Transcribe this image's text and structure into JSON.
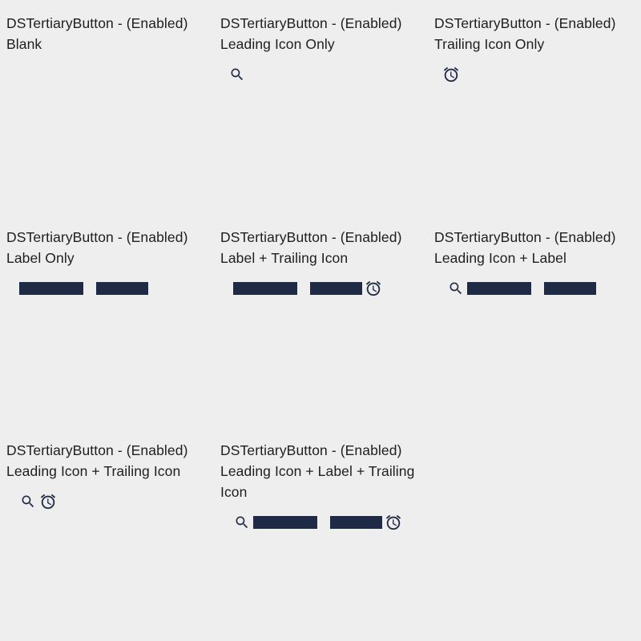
{
  "colors": {
    "background": "#eeeeee",
    "button_content": "#1f2a44",
    "text": "#1e1e1e"
  },
  "icons": {
    "leading": "search-icon",
    "trailing": "alarm-clock-icon"
  },
  "cells": [
    {
      "title_line1": "DSTertiaryButton - (Enabled)",
      "title_line2": "Blank",
      "variant": "blank"
    },
    {
      "title_line1": "DSTertiaryButton - (Enabled)",
      "title_line2": "Leading Icon Only",
      "variant": "leading-icon-only"
    },
    {
      "title_line1": "DSTertiaryButton - (Enabled)",
      "title_line2": "Trailing Icon Only",
      "variant": "trailing-icon-only"
    },
    {
      "title_line1": "DSTertiaryButton - (Enabled)",
      "title_line2": "Label Only",
      "variant": "label-only"
    },
    {
      "title_line1": "DSTertiaryButton - (Enabled)",
      "title_line2": "Label + Trailing Icon",
      "variant": "label-trailing-icon"
    },
    {
      "title_line1": "DSTertiaryButton - (Enabled)",
      "title_line2": "Leading Icon + Label",
      "variant": "leading-icon-label"
    },
    {
      "title_line1": "DSTertiaryButton - (Enabled)",
      "title_line2": "Leading Icon + Trailing Icon",
      "variant": "leading-trailing-icon"
    },
    {
      "title_line1": "DSTertiaryButton - (Enabled)",
      "title_line2": "Leading Icon + Label + Trailing Icon",
      "variant": "leading-label-trailing-icon"
    }
  ]
}
